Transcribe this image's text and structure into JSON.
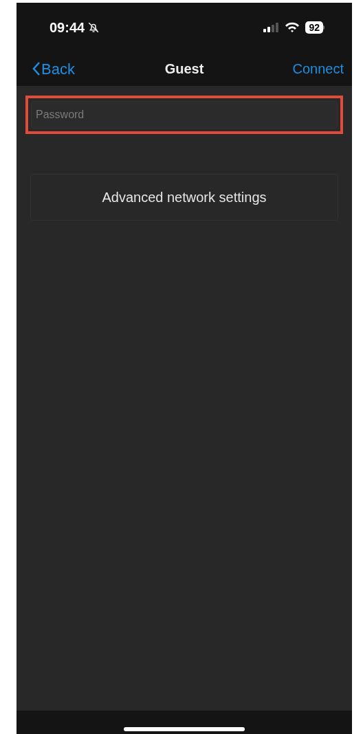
{
  "status_bar": {
    "time": "09:44",
    "battery": "92"
  },
  "nav_bar": {
    "back": "Back",
    "title": "Guest",
    "action": "Connect"
  },
  "password_field": {
    "placeholder": "Password"
  },
  "advanced_button": {
    "label": "Advanced network settings"
  }
}
